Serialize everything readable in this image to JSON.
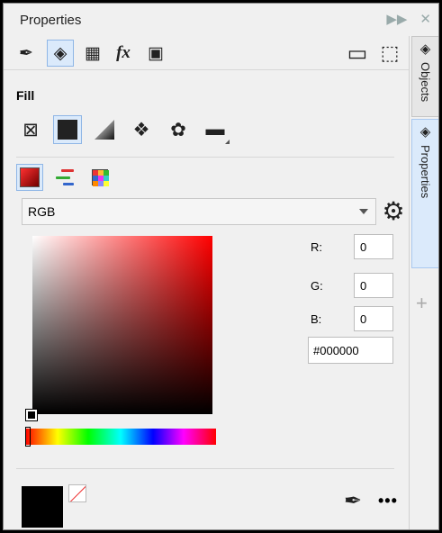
{
  "window": {
    "title": "Properties",
    "pin_icon": "collapse-arrows-icon",
    "close_icon": "close-icon"
  },
  "toolbar": {
    "left": [
      {
        "name": "outline-pen-icon",
        "glyph": "✒",
        "active": false
      },
      {
        "name": "fill-bucket-icon",
        "glyph": "◈",
        "active": true
      },
      {
        "name": "transparency-icon",
        "glyph": "▦",
        "active": false
      },
      {
        "name": "effects-icon",
        "glyph": "fx",
        "active": false
      },
      {
        "name": "summary-image-icon",
        "glyph": "▣",
        "active": false
      }
    ],
    "right": [
      {
        "name": "frame-icon",
        "glyph": "▭"
      },
      {
        "name": "page-settings-icon",
        "glyph": "⬚"
      }
    ]
  },
  "fill": {
    "title": "Fill",
    "types": [
      {
        "name": "no-fill-icon",
        "glyph": "⊠",
        "active": false
      },
      {
        "name": "uniform-fill-icon",
        "glyph": "",
        "active": true
      },
      {
        "name": "fountain-fill-icon",
        "glyph": "",
        "active": false
      },
      {
        "name": "vector-pattern-icon",
        "glyph": "❖",
        "active": false
      },
      {
        "name": "texture-fill-icon",
        "glyph": "✿",
        "active": false
      },
      {
        "name": "postscript-fill-icon",
        "glyph": "▬",
        "active": false
      }
    ]
  },
  "color_modes": [
    {
      "name": "color-viewer-icon",
      "active": true
    },
    {
      "name": "color-sliders-icon",
      "active": false
    },
    {
      "name": "color-palettes-icon",
      "active": false
    }
  ],
  "model": {
    "selected": "RGB"
  },
  "channels": [
    {
      "label": "R:",
      "value": "0"
    },
    {
      "label": "G:",
      "value": "0"
    },
    {
      "label": "B:",
      "value": "0"
    }
  ],
  "hex_value": "#000000",
  "colors": {
    "current": "#000000",
    "picker_hue": "#ff0000",
    "active_bg": "#dbeafb"
  },
  "tabs": {
    "objects_label": "Objects",
    "properties_label": "Properties",
    "add_glyph": "+"
  },
  "footer": {
    "more_glyph": "•••"
  }
}
